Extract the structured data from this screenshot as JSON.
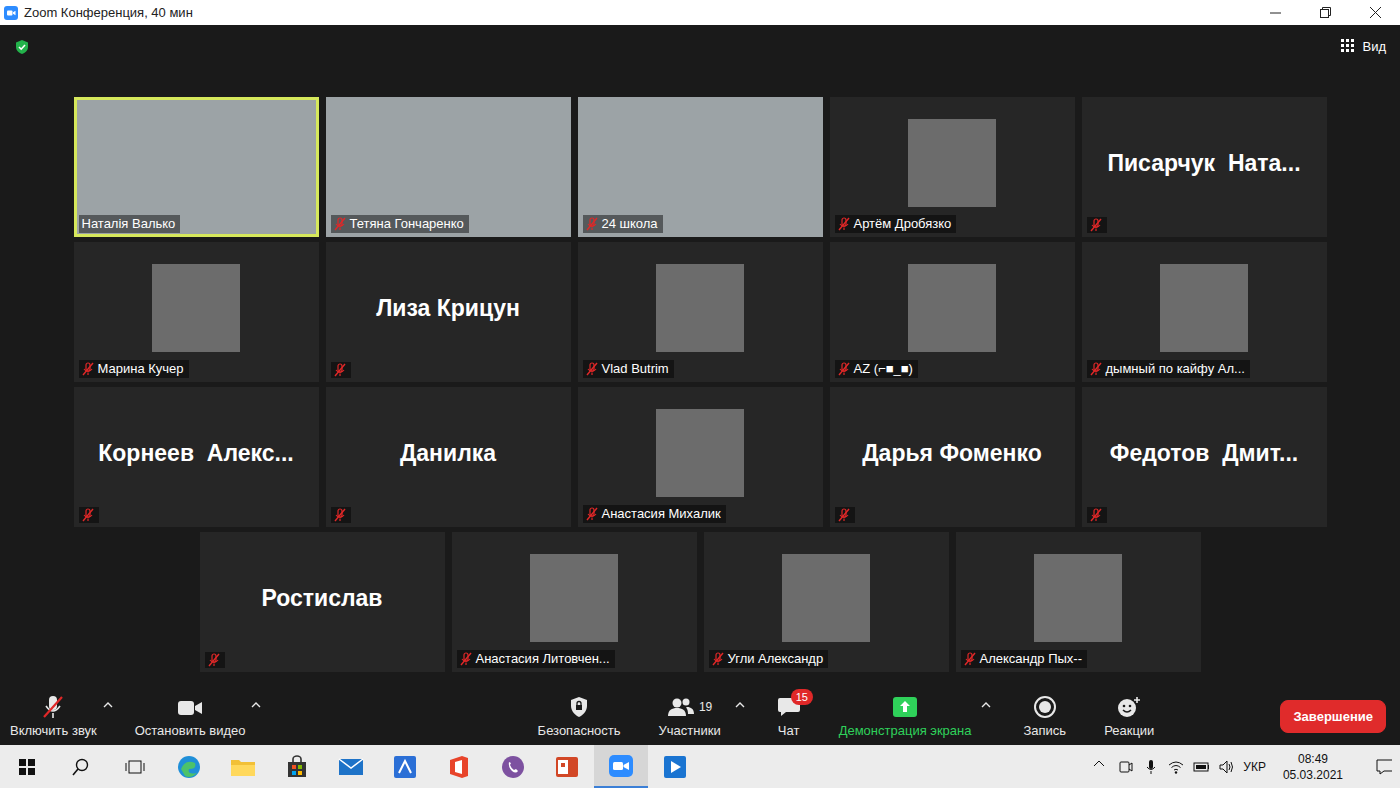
{
  "window": {
    "title": "Zoom Конференция, 40 мин"
  },
  "view_button": {
    "label": "Вид"
  },
  "tiles": [
    {
      "name": "Наталія Валько",
      "kind": "video",
      "muted": false,
      "speaking": true
    },
    {
      "name": "Тетяна Гончаренко",
      "kind": "video",
      "muted": true,
      "speaking": false
    },
    {
      "name": "24 школа",
      "kind": "video",
      "muted": true,
      "speaking": false
    },
    {
      "name": "Артём Дробязко",
      "kind": "avatar",
      "muted": true,
      "speaking": false
    },
    {
      "name": "Писарчук  Ната...",
      "kind": "name",
      "muted": true,
      "speaking": false
    },
    {
      "name": "Марина Кучер",
      "kind": "avatar",
      "muted": true,
      "speaking": false
    },
    {
      "name": "Лиза Крицун",
      "kind": "name",
      "muted": true,
      "speaking": false
    },
    {
      "name": "Vlad Butrim",
      "kind": "avatar",
      "muted": true,
      "speaking": false
    },
    {
      "name": "AZ (⌐■_■)",
      "kind": "avatar",
      "muted": true,
      "speaking": false
    },
    {
      "name": "дымный по кайфу Ал...",
      "kind": "avatar",
      "muted": true,
      "speaking": false
    },
    {
      "name": "Корнеев  Алекс...",
      "kind": "name",
      "muted": true,
      "speaking": false
    },
    {
      "name": "Данилка",
      "kind": "name",
      "muted": true,
      "speaking": false
    },
    {
      "name": "Анастасия Михалик",
      "kind": "avatar",
      "muted": true,
      "speaking": false
    },
    {
      "name": "Дарья Фоменко",
      "kind": "name",
      "muted": true,
      "speaking": false
    },
    {
      "name": "Федотов  Дмит...",
      "kind": "name",
      "muted": true,
      "speaking": false
    },
    {
      "name": "Ростислав",
      "kind": "name",
      "muted": true,
      "speaking": false
    },
    {
      "name": "Анастасия Литовчен...",
      "kind": "avatar",
      "muted": true,
      "speaking": false
    },
    {
      "name": "Угли Александр",
      "kind": "avatar",
      "muted": true,
      "speaking": false
    },
    {
      "name": "Александр Пых--",
      "kind": "avatar",
      "muted": true,
      "speaking": false
    }
  ],
  "toolbar": {
    "audio": {
      "label": "Включить звук",
      "muted": true
    },
    "video": {
      "label": "Остановить видео"
    },
    "security": {
      "label": "Безопасность"
    },
    "participants": {
      "label": "Участники",
      "count": "19"
    },
    "chat": {
      "label": "Чат",
      "badge": "15"
    },
    "share": {
      "label": "Демонстрация экрана"
    },
    "record": {
      "label": "Запись"
    },
    "reactions": {
      "label": "Реакции"
    },
    "end": {
      "label": "Завершение"
    }
  },
  "taskbar": {
    "apps": [
      {
        "selected": false
      },
      {
        "selected": false
      },
      {
        "selected": false
      },
      {
        "selected": false
      },
      {
        "selected": false
      },
      {
        "selected": false
      },
      {
        "selected": false
      },
      {
        "selected": false
      },
      {
        "selected": false
      },
      {
        "selected": false
      },
      {
        "selected": false
      },
      {
        "selected": true
      },
      {
        "selected": false
      }
    ],
    "language": "УКР",
    "time": "08:49",
    "date": "05.03.2021"
  }
}
